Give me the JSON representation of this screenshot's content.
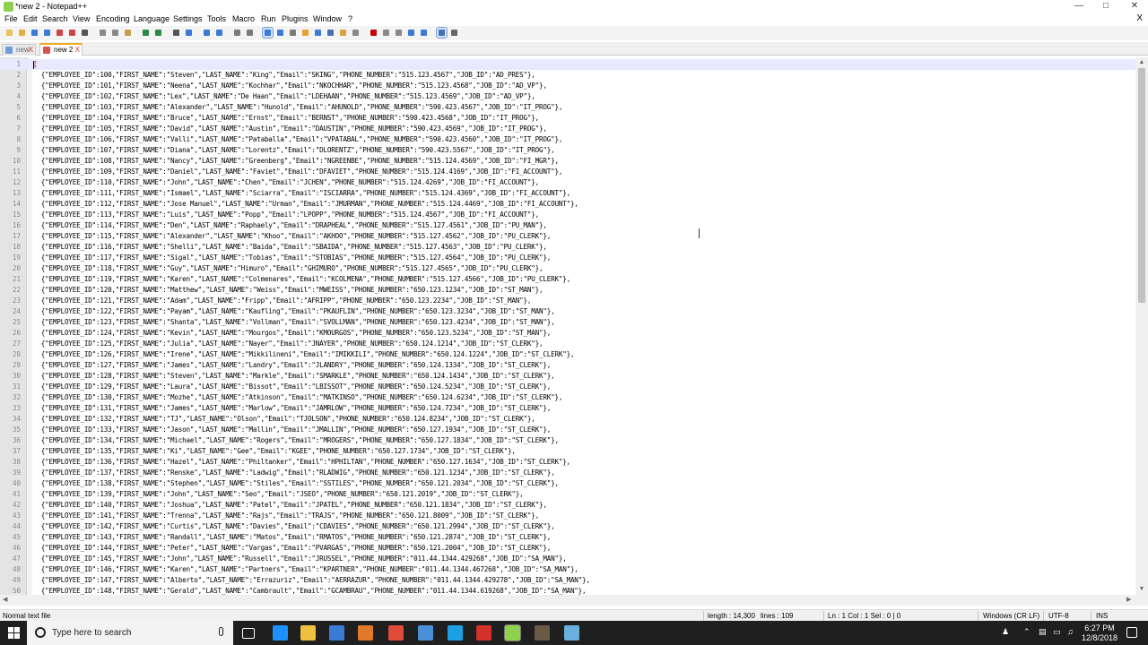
{
  "window": {
    "title": "*new 2 - Notepad++",
    "controls": [
      "minimize",
      "maximize",
      "close"
    ]
  },
  "menu": {
    "items": [
      "File",
      "Edit",
      "Search",
      "View",
      "Encoding",
      "Language",
      "Settings",
      "Tools",
      "Macro",
      "Run",
      "Plugins",
      "Window",
      "?"
    ],
    "close_x": "X"
  },
  "toolbar": {
    "icons": [
      "new-file-icon",
      "open-file-icon",
      "save-icon",
      "save-all-icon",
      "close-icon",
      "close-all-icon",
      "print-icon",
      "cut-icon",
      "copy-icon",
      "paste-icon",
      "undo-icon",
      "redo-icon",
      "find-icon",
      "replace-icon",
      "zoom-in-icon",
      "zoom-out-icon",
      "sync-v-icon",
      "sync-h-icon",
      "word-wrap-icon",
      "all-chars-icon",
      "indent-guide-icon",
      "lang-icon",
      "doc-map-icon",
      "func-list-icon",
      "folder-workspace-icon",
      "monitor-icon",
      "record-macro-icon",
      "stop-record-icon",
      "playback-icon",
      "run-multiple-icon",
      "save-macro-icon",
      "spell-check-icon",
      "spell-option-icon"
    ]
  },
  "tabs": [
    {
      "label": "new 1",
      "close": "X",
      "active": false
    },
    {
      "label": "new 2",
      "close": "X",
      "active": true
    }
  ],
  "editor": {
    "lines": [
      "[",
      "  {\"EMPLOYEE_ID\":100,\"FIRST_NAME\":\"Steven\",\"LAST_NAME\":\"King\",\"Email\":\"SKING\",\"PHONE_NUMBER\":\"515.123.4567\",\"JOB_ID\":\"AD_PRES\"},",
      "  {\"EMPLOYEE_ID\":101,\"FIRST_NAME\":\"Neena\",\"LAST_NAME\":\"Kochhar\",\"Email\":\"NKOCHHAR\",\"PHONE_NUMBER\":\"515.123.4568\",\"JOB_ID\":\"AD_VP\"},",
      "  {\"EMPLOYEE_ID\":102,\"FIRST_NAME\":\"Lex\",\"LAST_NAME\":\"De Haan\",\"Email\":\"LDEHAAN\",\"PHONE_NUMBER\":\"515.123.4569\",\"JOB_ID\":\"AD_VP\"},",
      "  {\"EMPLOYEE_ID\":103,\"FIRST_NAME\":\"Alexander\",\"LAST_NAME\":\"Hunold\",\"Email\":\"AHUNOLD\",\"PHONE_NUMBER\":\"590.423.4567\",\"JOB_ID\":\"IT_PROG\"},",
      "  {\"EMPLOYEE_ID\":104,\"FIRST_NAME\":\"Bruce\",\"LAST_NAME\":\"Ernst\",\"Email\":\"BERNST\",\"PHONE_NUMBER\":\"590.423.4568\",\"JOB_ID\":\"IT_PROG\"},",
      "  {\"EMPLOYEE_ID\":105,\"FIRST_NAME\":\"David\",\"LAST_NAME\":\"Austin\",\"Email\":\"DAUSTIN\",\"PHONE_NUMBER\":\"590.423.4569\",\"JOB_ID\":\"IT_PROG\"},",
      "  {\"EMPLOYEE_ID\":106,\"FIRST_NAME\":\"Valli\",\"LAST_NAME\":\"Pataballa\",\"Email\":\"VPATABAL\",\"PHONE_NUMBER\":\"590.423.4560\",\"JOB_ID\":\"IT_PROG\"},",
      "  {\"EMPLOYEE_ID\":107,\"FIRST_NAME\":\"Diana\",\"LAST_NAME\":\"Lorentz\",\"Email\":\"DLORENTZ\",\"PHONE_NUMBER\":\"590.423.5567\",\"JOB_ID\":\"IT_PROG\"},",
      "  {\"EMPLOYEE_ID\":108,\"FIRST_NAME\":\"Nancy\",\"LAST_NAME\":\"Greenberg\",\"Email\":\"NGREENBE\",\"PHONE_NUMBER\":\"515.124.4569\",\"JOB_ID\":\"FI_MGR\"},",
      "  {\"EMPLOYEE_ID\":109,\"FIRST_NAME\":\"Daniel\",\"LAST_NAME\":\"Faviet\",\"Email\":\"DFAVIET\",\"PHONE_NUMBER\":\"515.124.4169\",\"JOB_ID\":\"FI_ACCOUNT\"},",
      "  {\"EMPLOYEE_ID\":110,\"FIRST_NAME\":\"John\",\"LAST_NAME\":\"Chen\",\"Email\":\"JCHEN\",\"PHONE_NUMBER\":\"515.124.4269\",\"JOB_ID\":\"FI_ACCOUNT\"},",
      "  {\"EMPLOYEE_ID\":111,\"FIRST_NAME\":\"Ismael\",\"LAST_NAME\":\"Sciarra\",\"Email\":\"ISCIARRA\",\"PHONE_NUMBER\":\"515.124.4369\",\"JOB_ID\":\"FI_ACCOUNT\"},",
      "  {\"EMPLOYEE_ID\":112,\"FIRST_NAME\":\"Jose Manuel\",\"LAST_NAME\":\"Urman\",\"Email\":\"JMURMAN\",\"PHONE_NUMBER\":\"515.124.4469\",\"JOB_ID\":\"FI_ACCOUNT\"},",
      "  {\"EMPLOYEE_ID\":113,\"FIRST_NAME\":\"Luis\",\"LAST_NAME\":\"Popp\",\"Email\":\"LPOPP\",\"PHONE_NUMBER\":\"515.124.4567\",\"JOB_ID\":\"FI_ACCOUNT\"},",
      "  {\"EMPLOYEE_ID\":114,\"FIRST_NAME\":\"Den\",\"LAST_NAME\":\"Raphaely\",\"Email\":\"DRAPHEAL\",\"PHONE_NUMBER\":\"515.127.4561\",\"JOB_ID\":\"PU_MAN\"},",
      "  {\"EMPLOYEE_ID\":115,\"FIRST_NAME\":\"Alexander\",\"LAST_NAME\":\"Khoo\",\"Email\":\"AKHOO\",\"PHONE_NUMBER\":\"515.127.4562\",\"JOB_ID\":\"PU_CLERK\"},",
      "  {\"EMPLOYEE_ID\":116,\"FIRST_NAME\":\"Shelli\",\"LAST_NAME\":\"Baida\",\"Email\":\"SBAIDA\",\"PHONE_NUMBER\":\"515.127.4563\",\"JOB_ID\":\"PU_CLERK\"},",
      "  {\"EMPLOYEE_ID\":117,\"FIRST_NAME\":\"Sigal\",\"LAST_NAME\":\"Tobias\",\"Email\":\"STOBIAS\",\"PHONE_NUMBER\":\"515.127.4564\",\"JOB_ID\":\"PU_CLERK\"},",
      "  {\"EMPLOYEE_ID\":118,\"FIRST_NAME\":\"Guy\",\"LAST_NAME\":\"Himuro\",\"Email\":\"GHIMURO\",\"PHONE_NUMBER\":\"515.127.4565\",\"JOB_ID\":\"PU_CLERK\"},",
      "  {\"EMPLOYEE_ID\":119,\"FIRST_NAME\":\"Karen\",\"LAST_NAME\":\"Colmenares\",\"Email\":\"KCOLMENA\",\"PHONE_NUMBER\":\"515.127.4566\",\"JOB_ID\":\"PU_CLERK\"},",
      "  {\"EMPLOYEE_ID\":120,\"FIRST_NAME\":\"Matthew\",\"LAST_NAME\":\"Weiss\",\"Email\":\"MWEISS\",\"PHONE_NUMBER\":\"650.123.1234\",\"JOB_ID\":\"ST_MAN\"},",
      "  {\"EMPLOYEE_ID\":121,\"FIRST_NAME\":\"Adam\",\"LAST_NAME\":\"Fripp\",\"Email\":\"AFRIPP\",\"PHONE_NUMBER\":\"650.123.2234\",\"JOB_ID\":\"ST_MAN\"},",
      "  {\"EMPLOYEE_ID\":122,\"FIRST_NAME\":\"Payam\",\"LAST_NAME\":\"Kaufling\",\"Email\":\"PKAUFLIN\",\"PHONE_NUMBER\":\"650.123.3234\",\"JOB_ID\":\"ST_MAN\"},",
      "  {\"EMPLOYEE_ID\":123,\"FIRST_NAME\":\"Shanta\",\"LAST_NAME\":\"Vollman\",\"Email\":\"SVOLLMAN\",\"PHONE_NUMBER\":\"650.123.4234\",\"JOB_ID\":\"ST_MAN\"},",
      "  {\"EMPLOYEE_ID\":124,\"FIRST_NAME\":\"Kevin\",\"LAST_NAME\":\"Mourgos\",\"Email\":\"KMOURGOS\",\"PHONE_NUMBER\":\"650.123.5234\",\"JOB_ID\":\"ST_MAN\"},",
      "  {\"EMPLOYEE_ID\":125,\"FIRST_NAME\":\"Julia\",\"LAST_NAME\":\"Nayer\",\"Email\":\"JNAYER\",\"PHONE_NUMBER\":\"650.124.1214\",\"JOB_ID\":\"ST_CLERK\"},",
      "  {\"EMPLOYEE_ID\":126,\"FIRST_NAME\":\"Irene\",\"LAST_NAME\":\"Mikkilineni\",\"Email\":\"IMIKKILI\",\"PHONE_NUMBER\":\"650.124.1224\",\"JOB_ID\":\"ST_CLERK\"},",
      "  {\"EMPLOYEE_ID\":127,\"FIRST_NAME\":\"James\",\"LAST_NAME\":\"Landry\",\"Email\":\"JLANDRY\",\"PHONE_NUMBER\":\"650.124.1334\",\"JOB_ID\":\"ST_CLERK\"},",
      "  {\"EMPLOYEE_ID\":128,\"FIRST_NAME\":\"Steven\",\"LAST_NAME\":\"Markle\",\"Email\":\"SMARKLE\",\"PHONE_NUMBER\":\"650.124.1434\",\"JOB_ID\":\"ST_CLERK\"},",
      "  {\"EMPLOYEE_ID\":129,\"FIRST_NAME\":\"Laura\",\"LAST_NAME\":\"Bissot\",\"Email\":\"LBISSOT\",\"PHONE_NUMBER\":\"650.124.5234\",\"JOB_ID\":\"ST_CLERK\"},",
      "  {\"EMPLOYEE_ID\":130,\"FIRST_NAME\":\"Mozhe\",\"LAST_NAME\":\"Atkinson\",\"Email\":\"MATKINSO\",\"PHONE_NUMBER\":\"650.124.6234\",\"JOB_ID\":\"ST_CLERK\"},",
      "  {\"EMPLOYEE_ID\":131,\"FIRST_NAME\":\"James\",\"LAST_NAME\":\"Marlow\",\"Email\":\"JAMRLOW\",\"PHONE_NUMBER\":\"650.124.7234\",\"JOB_ID\":\"ST_CLERK\"},",
      "  {\"EMPLOYEE_ID\":132,\"FIRST_NAME\":\"TJ\",\"LAST_NAME\":\"Olson\",\"Email\":\"TJOLSON\",\"PHONE_NUMBER\":\"650.124.8234\",\"JOB_ID\":\"ST_CLERK\"},",
      "  {\"EMPLOYEE_ID\":133,\"FIRST_NAME\":\"Jason\",\"LAST_NAME\":\"Mallin\",\"Email\":\"JMALLIN\",\"PHONE_NUMBER\":\"650.127.1934\",\"JOB_ID\":\"ST_CLERK\"},",
      "  {\"EMPLOYEE_ID\":134,\"FIRST_NAME\":\"Michael\",\"LAST_NAME\":\"Rogers\",\"Email\":\"MROGERS\",\"PHONE_NUMBER\":\"650.127.1834\",\"JOB_ID\":\"ST_CLERK\"},",
      "  {\"EMPLOYEE_ID\":135,\"FIRST_NAME\":\"Ki\",\"LAST_NAME\":\"Gee\",\"Email\":\"KGEE\",\"PHONE_NUMBER\":\"650.127.1734\",\"JOB_ID\":\"ST_CLERK\"},",
      "  {\"EMPLOYEE_ID\":136,\"FIRST_NAME\":\"Hazel\",\"LAST_NAME\":\"Philtanker\",\"Email\":\"HPHILTAN\",\"PHONE_NUMBER\":\"650.127.1634\",\"JOB_ID\":\"ST_CLERK\"},",
      "  {\"EMPLOYEE_ID\":137,\"FIRST_NAME\":\"Renske\",\"LAST_NAME\":\"Ladwig\",\"Email\":\"RLADWIG\",\"PHONE_NUMBER\":\"650.121.1234\",\"JOB_ID\":\"ST_CLERK\"},",
      "  {\"EMPLOYEE_ID\":138,\"FIRST_NAME\":\"Stephen\",\"LAST_NAME\":\"Stiles\",\"Email\":\"SSTILES\",\"PHONE_NUMBER\":\"650.121.2034\",\"JOB_ID\":\"ST_CLERK\"},",
      "  {\"EMPLOYEE_ID\":139,\"FIRST_NAME\":\"John\",\"LAST_NAME\":\"Seo\",\"Email\":\"JSEO\",\"PHONE_NUMBER\":\"650.121.2019\",\"JOB_ID\":\"ST_CLERK\"},",
      "  {\"EMPLOYEE_ID\":140,\"FIRST_NAME\":\"Joshua\",\"LAST_NAME\":\"Patel\",\"Email\":\"JPATEL\",\"PHONE_NUMBER\":\"650.121.1834\",\"JOB_ID\":\"ST_CLERK\"},",
      "  {\"EMPLOYEE_ID\":141,\"FIRST_NAME\":\"Trenna\",\"LAST_NAME\":\"Rajs\",\"Email\":\"TRAJS\",\"PHONE_NUMBER\":\"650.121.8009\",\"JOB_ID\":\"ST_CLERK\"},",
      "  {\"EMPLOYEE_ID\":142,\"FIRST_NAME\":\"Curtis\",\"LAST_NAME\":\"Davies\",\"Email\":\"CDAVIES\",\"PHONE_NUMBER\":\"650.121.2994\",\"JOB_ID\":\"ST_CLERK\"},",
      "  {\"EMPLOYEE_ID\":143,\"FIRST_NAME\":\"Randall\",\"LAST_NAME\":\"Matos\",\"Email\":\"RMATOS\",\"PHONE_NUMBER\":\"650.121.2874\",\"JOB_ID\":\"ST_CLERK\"},",
      "  {\"EMPLOYEE_ID\":144,\"FIRST_NAME\":\"Peter\",\"LAST_NAME\":\"Vargas\",\"Email\":\"PVARGAS\",\"PHONE_NUMBER\":\"650.121.2004\",\"JOB_ID\":\"ST_CLERK\"},",
      "  {\"EMPLOYEE_ID\":145,\"FIRST_NAME\":\"John\",\"LAST_NAME\":\"Russell\",\"Email\":\"JRUSSEL\",\"PHONE_NUMBER\":\"011.44.1344.429268\",\"JOB_ID\":\"SA_MAN\"},",
      "  {\"EMPLOYEE_ID\":146,\"FIRST_NAME\":\"Karen\",\"LAST_NAME\":\"Partners\",\"Email\":\"KPARTNER\",\"PHONE_NUMBER\":\"011.44.1344.467268\",\"JOB_ID\":\"SA_MAN\"},",
      "  {\"EMPLOYEE_ID\":147,\"FIRST_NAME\":\"Alberto\",\"LAST_NAME\":\"Errazuriz\",\"Email\":\"AERRAZUR\",\"PHONE_NUMBER\":\"011.44.1344.429278\",\"JOB_ID\":\"SA_MAN\"},",
      "  {\"EMPLOYEE_ID\":148,\"FIRST_NAME\":\"Gerald\",\"LAST_NAME\":\"Cambrault\",\"Email\":\"GCAMBRAU\",\"PHONE_NUMBER\":\"011.44.1344.619268\",\"JOB_ID\":\"SA_MAN\"},"
    ],
    "current_line": 1
  },
  "statusbar": {
    "filetype": "Normal text file",
    "length": "length : 14,300",
    "lines": "lines : 109",
    "position": "Ln : 1    Col : 1    Sel : 0 | 0",
    "eol": "Windows (CR LF)",
    "encoding": "UTF-8",
    "mode": "INS"
  },
  "taskbar": {
    "search_placeholder": "Type here to search",
    "apps": [
      "task-view-icon",
      "edge-icon",
      "file-explorer-icon",
      "store-icon",
      "media-player-icon",
      "chrome-icon",
      "mail-icon",
      "skype-icon",
      "acrobat-icon",
      "notepadpp-icon",
      "gimp-icon",
      "notepad-icon"
    ],
    "time": "6:27 PM",
    "date": "12/8/2018"
  },
  "colors": {
    "accent_tab": "#f5a623",
    "current_line": "#e8e8ff",
    "taskbar": "#1f1f1f"
  }
}
